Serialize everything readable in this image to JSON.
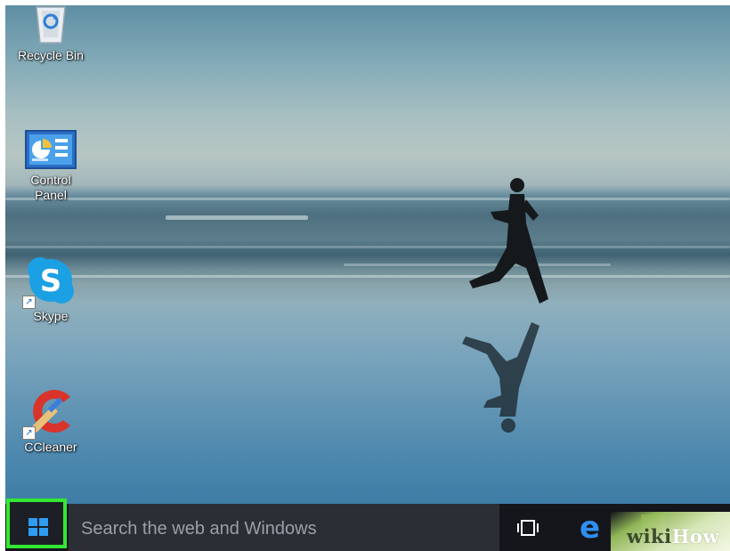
{
  "desktop": {
    "icons": [
      {
        "label": "Recycle Bin",
        "icon": "recycle-bin-icon",
        "shortcut": false
      },
      {
        "label": "Control\nPanel",
        "icon": "control-panel-icon",
        "shortcut": false
      },
      {
        "label": "Skype",
        "icon": "skype-icon",
        "shortcut": true
      },
      {
        "label": "CCleaner",
        "icon": "ccleaner-icon",
        "shortcut": true
      }
    ]
  },
  "taskbar": {
    "start_icon": "windows-logo-icon",
    "search_placeholder": "Search the web and Windows",
    "task_view_icon": "task-view-icon",
    "edge_glyph": "e",
    "edge_icon": "edge-browser-icon",
    "highlight_color": "#33e833"
  },
  "watermark": {
    "prefix": "wiki",
    "suffix": "How"
  }
}
